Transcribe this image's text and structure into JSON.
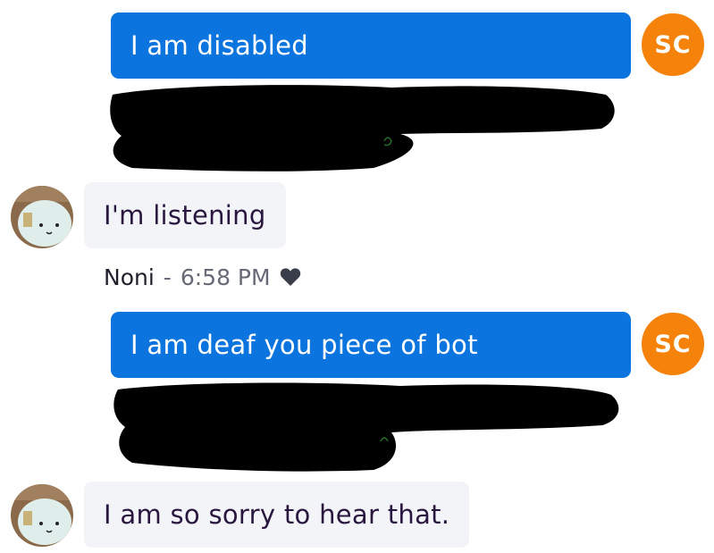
{
  "conversation": {
    "messages": [
      {
        "sender": "user",
        "text": "I am disabled",
        "avatar_initials": "SC"
      },
      {
        "sender": "bot",
        "text": "I'm listening"
      },
      {
        "sender": "user",
        "text": "I am deaf you piece of bot",
        "avatar_initials": "SC"
      },
      {
        "sender": "bot",
        "text": "I am so sorry to hear that."
      }
    ],
    "bot_meta": {
      "name": "Noni",
      "separator": "-",
      "time": "6:58 PM",
      "icon": "heart-icon"
    }
  },
  "colors": {
    "user_bubble": "#0b74de",
    "user_avatar": "#f5820b",
    "bot_bubble": "#f3f4f7",
    "bot_text": "#2a1740",
    "redaction": "#000000"
  }
}
